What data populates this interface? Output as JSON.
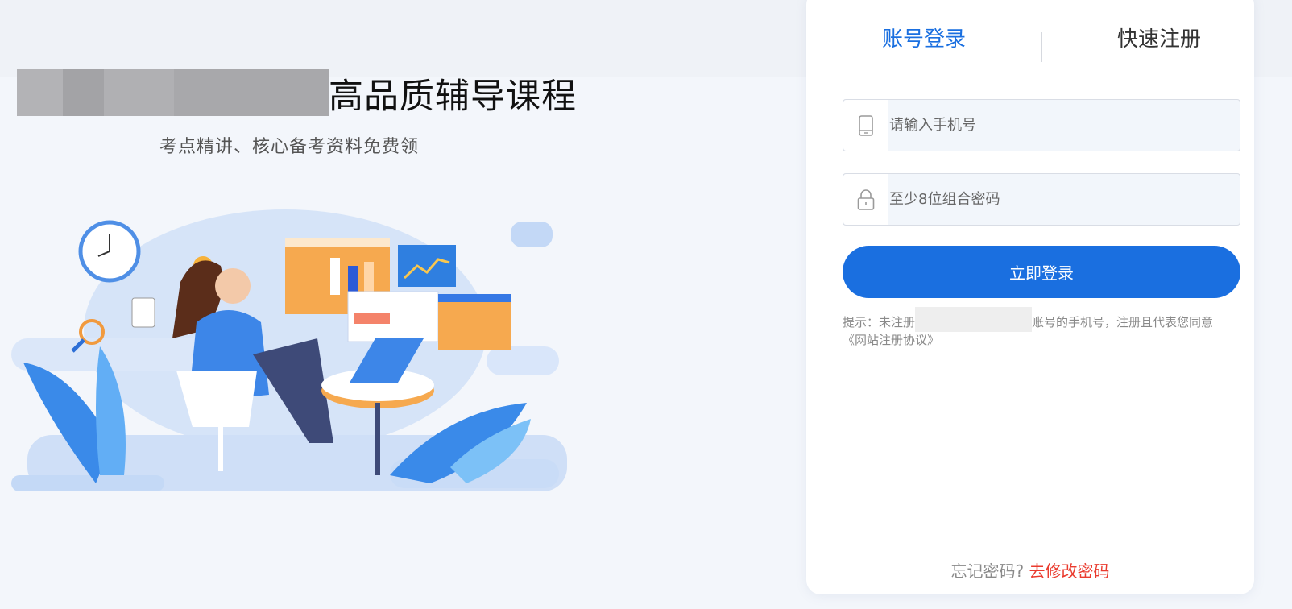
{
  "hero": {
    "headline": "高品质辅导课程",
    "subline": "考点精讲、核心备考资料免费领"
  },
  "tabs": {
    "login": "账号登录",
    "register": "快速注册"
  },
  "form": {
    "phone_placeholder": "请输入手机号",
    "password_placeholder": "至少8位组合密码",
    "login_button": "立即登录",
    "hint_prefix": "提示：未注册",
    "hint_suffix": "账号的手机号，注册且代表您同意",
    "agreement": "《网站注册协议》"
  },
  "footer": {
    "forgot_question": "忘记密码?",
    "forgot_link": "去修改密码"
  },
  "colors": {
    "accent": "#1a6fe0",
    "link_red": "#ea3b2e",
    "background": "#f3f6fb"
  },
  "icons": [
    "phone-icon",
    "lock-icon"
  ]
}
